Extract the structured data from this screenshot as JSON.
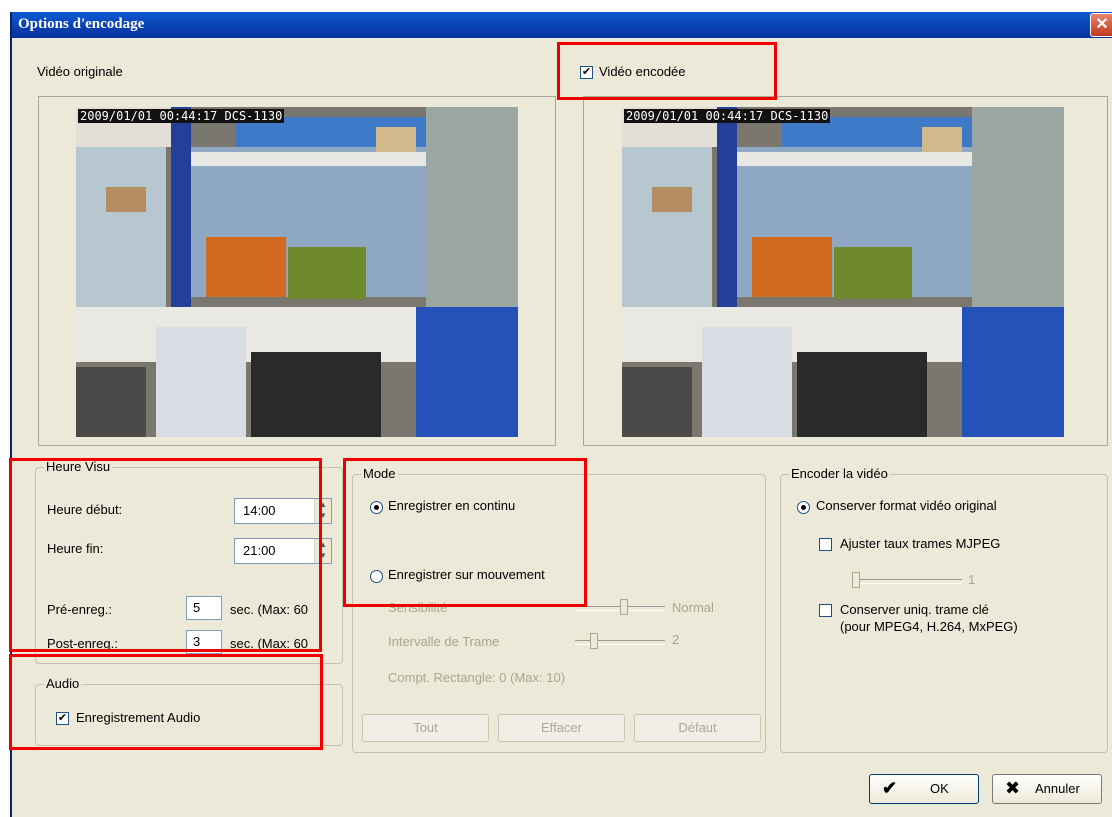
{
  "window": {
    "title": "Options d'encodage",
    "close_glyph": "✕"
  },
  "video": {
    "original_label": "Vidéo originale",
    "encoded_label": "Vidéo encodée",
    "encoded_checked": true,
    "overlay_text": "2009/01/01 00:44:17 DCS-1130"
  },
  "heure_visu": {
    "legend": "Heure Visu",
    "start_label": "Heure début:",
    "start_value": "14:00",
    "end_label": "Heure fin:",
    "end_value": "21:00",
    "pre_label": "Pré-enreg.:",
    "pre_value": "5",
    "post_label": "Post-enreg.:",
    "post_value": "3",
    "max_label": "sec. (Max: 60"
  },
  "audio": {
    "legend": "Audio",
    "record_label": "Enregistrement Audio",
    "record_checked": true
  },
  "mode": {
    "legend": "Mode",
    "continuous_label": "Enregistrer en continu",
    "continuous_selected": true,
    "motion_label": "Enregistrer sur mouvement",
    "sensitivity_label": "Sensibilité",
    "sensitivity_value": "Normal",
    "interval_label": "Intervalle de Trame",
    "interval_value": "2",
    "rect_count_label": "Compt. Rectangle: 0  (Max: 10)",
    "btn_all": "Tout",
    "btn_clear": "Effacer",
    "btn_default": "Défaut"
  },
  "encode": {
    "legend": "Encoder la vidéo",
    "keep_original_label": "Conserver format vidéo original",
    "keep_original_selected": true,
    "adjust_mjpeg_label": "Ajuster taux trames MJPEG",
    "adjust_mjpeg_checked": false,
    "mjpeg_value": "1",
    "keyframe_label_1": "Conserver uniq. trame clé",
    "keyframe_label_2": "(pour MPEG4, H.264, MxPEG)",
    "keyframe_checked": false
  },
  "footer": {
    "ok_label": "OK",
    "cancel_label": "Annuler",
    "ok_glyph": "✔",
    "cancel_glyph": "✖"
  }
}
